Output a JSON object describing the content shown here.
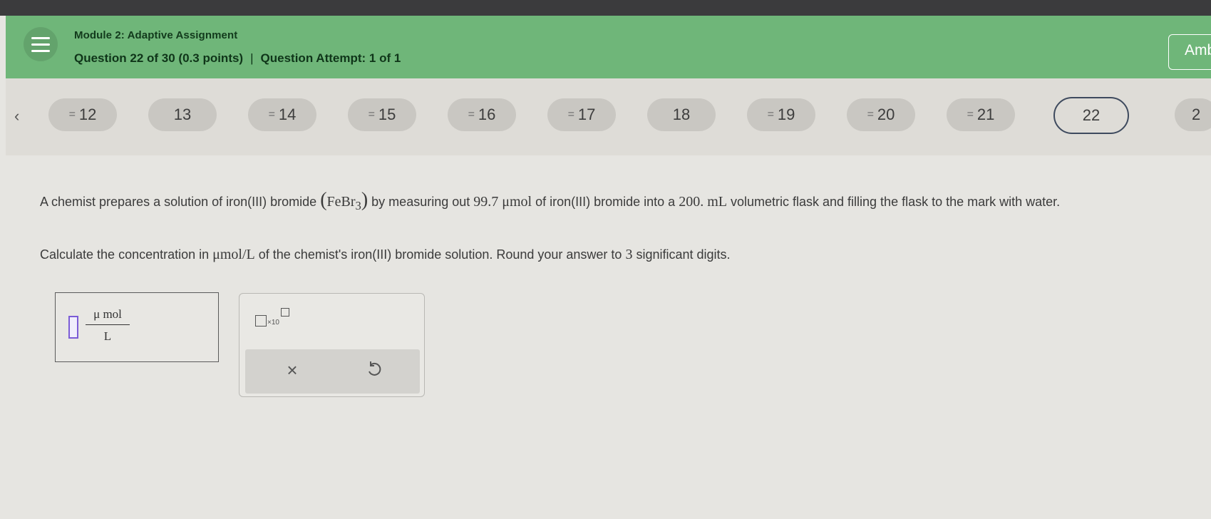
{
  "header": {
    "module_title": "Module 2: Adaptive Assignment",
    "question_position": "Question 22 of 30 (0.3 points)",
    "separator": "|",
    "attempt": "Question Attempt: 1 of 1",
    "user_button": "Amb",
    "bg_color": "#6fb679"
  },
  "nav": {
    "prev_glyph": "‹",
    "questions": [
      {
        "number": "12",
        "answered": true
      },
      {
        "number": "13",
        "answered": false
      },
      {
        "number": "14",
        "answered": true
      },
      {
        "number": "15",
        "answered": true
      },
      {
        "number": "16",
        "answered": true
      },
      {
        "number": "17",
        "answered": true
      },
      {
        "number": "18",
        "answered": false
      },
      {
        "number": "19",
        "answered": true
      },
      {
        "number": "20",
        "answered": true
      },
      {
        "number": "21",
        "answered": true
      },
      {
        "number": "22",
        "answered": false,
        "current": true
      },
      {
        "number": "2",
        "answered": false
      }
    ],
    "answered_glyph": "="
  },
  "problem": {
    "part1": "A chemist prepares a solution of iron(III) bromide ",
    "formula_open": "(",
    "formula_main": "FeBr",
    "formula_sub": "3",
    "formula_close": ")",
    "part2": " by measuring out ",
    "amount": "99.7 μmol",
    "part3": " of iron(III) bromide into a ",
    "volume": "200. mL",
    "part4": " volumetric flask and filling the flask to the mark with water.",
    "instr1": "Calculate the concentration in ",
    "unit": "μmol/L",
    "instr2": " of the chemist's iron(III) bromide solution. Round your answer to ",
    "sig": "3",
    "instr3": " significant digits."
  },
  "answer": {
    "unit_numerator": "μ mol",
    "unit_denominator": "L",
    "value": ""
  },
  "tools": {
    "x10_label": "×10",
    "clear_glyph": "×",
    "undo_icon": "undo-icon"
  }
}
